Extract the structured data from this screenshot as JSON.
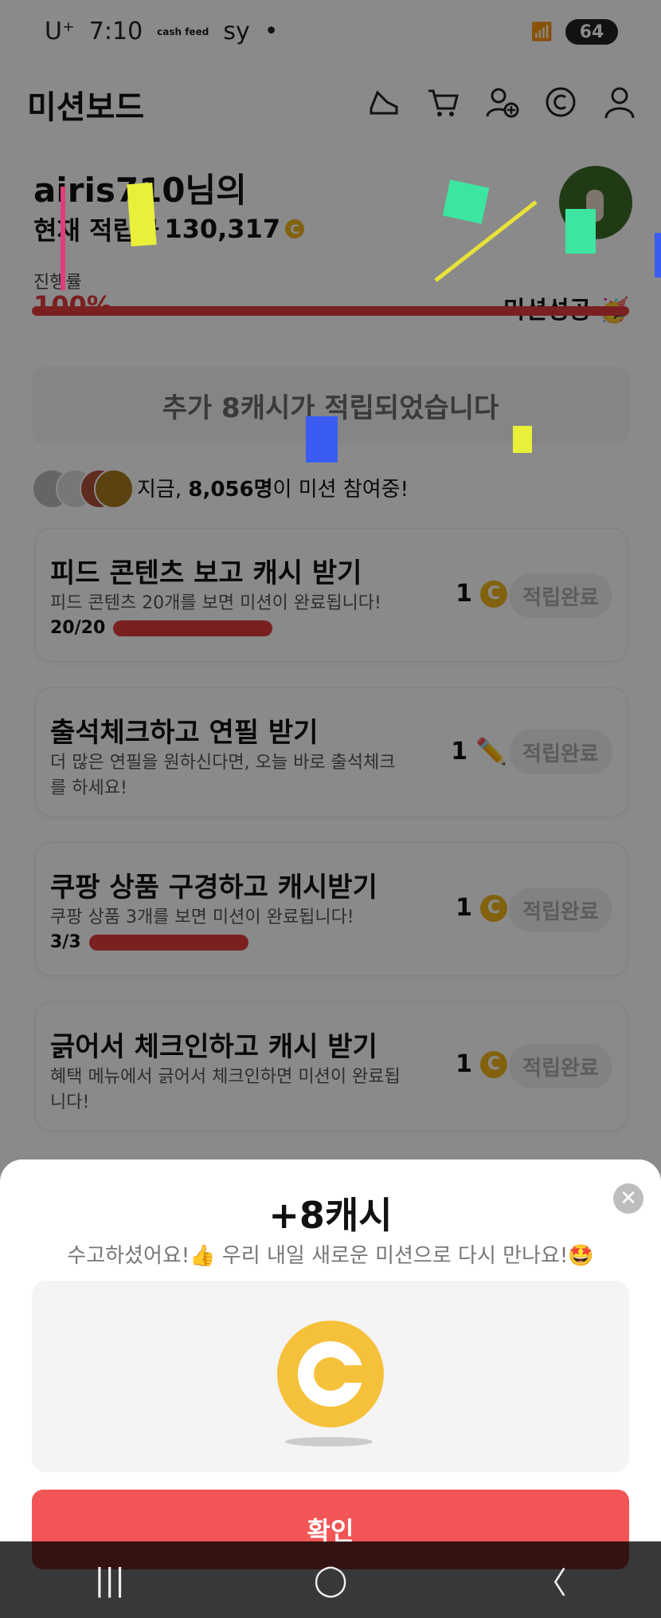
{
  "status_bar": {
    "carrier": "U⁺",
    "time": "7:10",
    "app1": "cash feed",
    "app2": "sy",
    "battery": "64"
  },
  "header": {
    "title": "미션보드",
    "icons": [
      "shoe-icon",
      "cart-icon",
      "add-friend-icon",
      "cash-icon",
      "profile-icon"
    ]
  },
  "summary": {
    "greeting": "airis710님의",
    "points_label": "현재 적립금",
    "points_value": "130,317",
    "progress_label": "진행률",
    "progress_value": "100%",
    "mission_status": "미션성공 🥳"
  },
  "banner": "추가 8캐시가 적립되었습니다",
  "participants": {
    "prefix": "지금, ",
    "count": "8,056명",
    "suffix": "이 미션 참여중!"
  },
  "missions": [
    {
      "title": "피드 콘텐츠 보고 캐시 받기",
      "desc": "피드 콘텐츠 20개를 보면 미션이 완료됩니다!",
      "progress": "20/20",
      "reward": "1",
      "reward_icon": "coin-icon",
      "button": "적립완료"
    },
    {
      "title": "출석체크하고 연필 받기",
      "desc": "더 많은 연필을 원하신다면, 오늘 바로 출석체크를 하세요!",
      "progress": "",
      "reward": "1",
      "reward_icon": "pencil-icon",
      "button": "적립완료"
    },
    {
      "title": "쿠팡 상품 구경하고 캐시받기",
      "desc": "쿠팡 상품 3개를 보면 미션이 완료됩니다!",
      "progress": "3/3",
      "reward": "1",
      "reward_icon": "coin-icon",
      "button": "적립완료"
    },
    {
      "title": "긁어서 체크인하고 캐시 받기",
      "desc": "혜택 메뉴에서 긁어서 체크인하면 미션이 완료됩니다!",
      "progress": "",
      "reward": "1",
      "reward_icon": "coin-icon",
      "button": "적립완료"
    }
  ],
  "sheet": {
    "amount": "+8캐시",
    "message": "수고하셨어요!👍 우리 내일 새로운 미션으로 다시 만나요!🤩",
    "confirm": "확인"
  },
  "nav": {
    "recent": "|||",
    "home": "◯",
    "back": "〈"
  },
  "colors": {
    "accent": "#e23c3c",
    "confirm": "#f25555",
    "coin": "#f1b51c"
  }
}
